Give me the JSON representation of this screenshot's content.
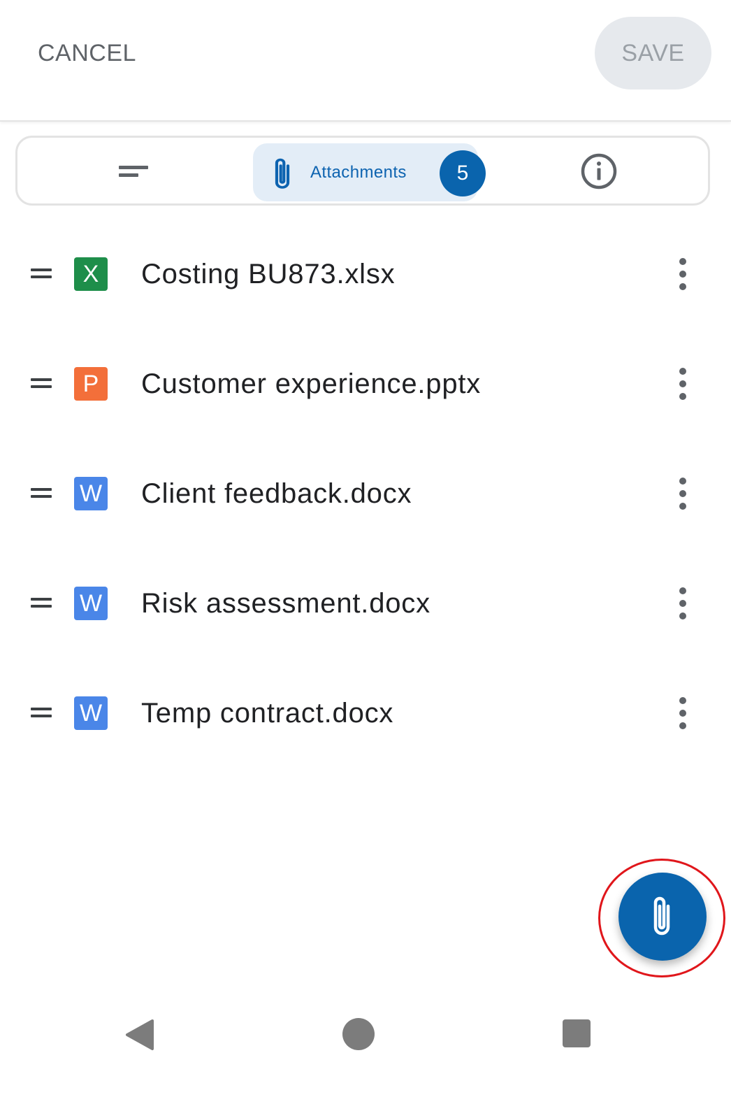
{
  "header": {
    "cancel_label": "CANCEL",
    "save_label": "SAVE"
  },
  "tabs": {
    "attachments_label": "Attachments",
    "attachments_count": "5"
  },
  "attachments": [
    {
      "name": "Costing BU873.xlsx",
      "type_letter": "X",
      "color": "#1e8e4a"
    },
    {
      "name": "Customer experience.pptx",
      "type_letter": "P",
      "color": "#f36f3a"
    },
    {
      "name": "Client feedback.docx",
      "type_letter": "W",
      "color": "#4a86e8"
    },
    {
      "name": "Risk assessment.docx",
      "type_letter": "W",
      "color": "#4a86e8"
    },
    {
      "name": "Temp contract.docx",
      "type_letter": "W",
      "color": "#4a86e8"
    }
  ],
  "colors": {
    "accent": "#0a64ad",
    "highlight_ring": "#e0161b"
  },
  "icons": {
    "details_tab": "short-text-icon",
    "attachments_tab": "paperclip-icon",
    "info_tab": "info-circle-icon",
    "fab": "paperclip-icon",
    "row_drag": "drag-handle-icon",
    "row_menu": "more-vertical-icon"
  }
}
